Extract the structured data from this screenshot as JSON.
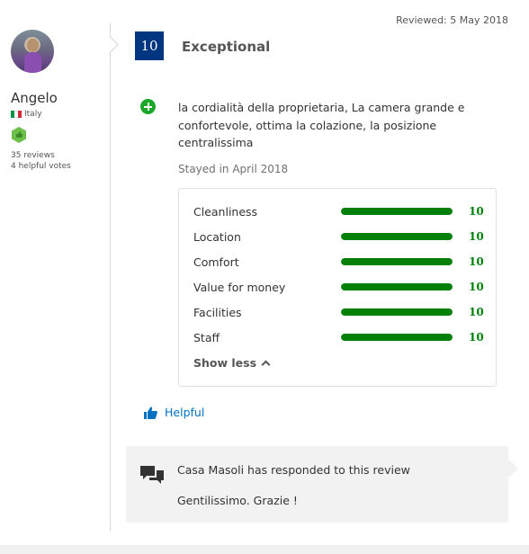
{
  "reviewer": {
    "name": "Angelo",
    "country": "Italy",
    "reviews_count": "35 reviews",
    "helpful_votes": "4 helpful votes",
    "flag_colors": [
      "#009246",
      "#ffffff",
      "#ce2b37"
    ],
    "badge_color": "#6cc04a"
  },
  "review": {
    "reviewed_date": "Reviewed: 5 May 2018",
    "score": "10",
    "score_word": "Exceptional",
    "positive_text": "la cordialità della proprietaria, La camera grande e confortevole, ottima la colazione, la posizione centralissima",
    "stayed": "Stayed in April 2018"
  },
  "ratings": [
    {
      "label": "Cleanliness",
      "value": "10",
      "fill": 1.0
    },
    {
      "label": "Location",
      "value": "10",
      "fill": 1.0
    },
    {
      "label": "Comfort",
      "value": "10",
      "fill": 1.0
    },
    {
      "label": "Value for money",
      "value": "10",
      "fill": 1.0
    },
    {
      "label": "Facilities",
      "value": "10",
      "fill": 1.0
    },
    {
      "label": "Staff",
      "value": "10",
      "fill": 1.0
    }
  ],
  "ratings_toggle": "Show less",
  "helpful_label": "Helpful",
  "response": {
    "title": "Casa Masoli has responded to this review",
    "text": "Gentilissimo. Grazie !"
  },
  "colors": {
    "score_bg": "#003580",
    "rating_green": "#008009",
    "positive_icon": "#1aa72a",
    "link_blue": "#0071c2"
  },
  "icons": {
    "positive": "plus-circle-icon",
    "helpful": "thumbs-up-icon",
    "response": "chat-bubbles-icon",
    "toggle": "chevron-up-icon",
    "badge": "hexagon-badge-icon"
  }
}
